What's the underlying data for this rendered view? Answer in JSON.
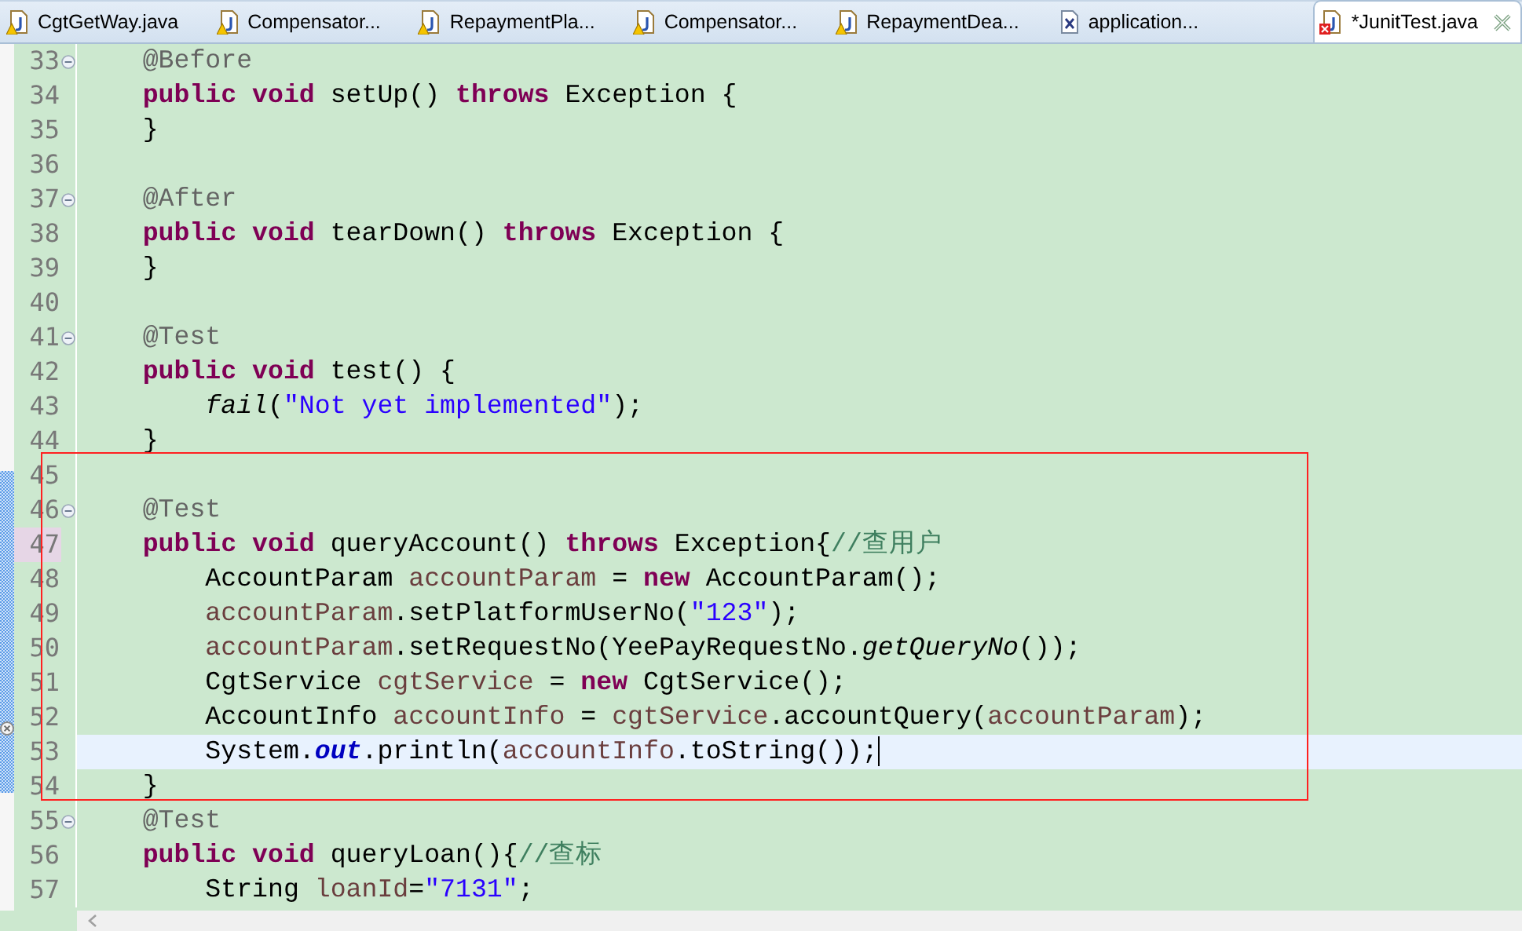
{
  "tabs": [
    {
      "label": "CgtGetWay.java",
      "kind": "java",
      "has_warning": true,
      "selected": false
    },
    {
      "label": "Compensator...",
      "kind": "java",
      "has_warning": true,
      "selected": false
    },
    {
      "label": "RepaymentPla...",
      "kind": "java",
      "has_warning": true,
      "selected": false
    },
    {
      "label": "Compensator...",
      "kind": "java",
      "has_warning": true,
      "selected": false
    },
    {
      "label": "RepaymentDea...",
      "kind": "java",
      "has_warning": true,
      "selected": false
    },
    {
      "label": "application...",
      "kind": "xml",
      "selected": false
    },
    {
      "label": "*JunitTest.java",
      "kind": "java",
      "has_error": true,
      "selected": true
    }
  ],
  "lines": [
    {
      "number": "33",
      "folding": true,
      "tokens": [
        {
          "kind": "annotation",
          "text": "    @Before"
        }
      ]
    },
    {
      "number": "34",
      "tokens": [
        {
          "kind": "keyword",
          "text": "    public void"
        },
        {
          "kind": "plain",
          "text": " setUp() "
        },
        {
          "kind": "keyword",
          "text": "throws"
        },
        {
          "kind": "plain",
          "text": " Exception {"
        }
      ]
    },
    {
      "number": "35",
      "tokens": [
        {
          "kind": "plain",
          "text": "    }"
        }
      ]
    },
    {
      "number": "36"
    },
    {
      "number": "37",
      "folding": true,
      "tokens": [
        {
          "kind": "annotation",
          "text": "    @After"
        }
      ]
    },
    {
      "number": "38",
      "tokens": [
        {
          "kind": "keyword",
          "text": "    public void"
        },
        {
          "kind": "plain",
          "text": " tearDown() "
        },
        {
          "kind": "keyword",
          "text": "throws"
        },
        {
          "kind": "plain",
          "text": " Exception {"
        }
      ]
    },
    {
      "number": "39",
      "tokens": [
        {
          "kind": "plain",
          "text": "    }"
        }
      ]
    },
    {
      "number": "40"
    },
    {
      "number": "41",
      "folding": true,
      "tokens": [
        {
          "kind": "annotation",
          "text": "    @Test"
        }
      ]
    },
    {
      "number": "42",
      "tokens": [
        {
          "kind": "keyword",
          "text": "    public void"
        },
        {
          "kind": "plain",
          "text": " test() {"
        }
      ]
    },
    {
      "number": "43",
      "tokens": [
        {
          "kind": "static-method",
          "text": "        fail"
        },
        {
          "kind": "plain",
          "text": "("
        },
        {
          "kind": "string",
          "text": "\"Not yet implemented\""
        },
        {
          "kind": "plain",
          "text": ");"
        }
      ]
    },
    {
      "number": "44",
      "tokens": [
        {
          "kind": "plain",
          "text": "    }"
        }
      ]
    },
    {
      "number": "45"
    },
    {
      "number": "46",
      "folding": true,
      "tokens": [
        {
          "kind": "annotation",
          "text": "    @Test"
        }
      ]
    },
    {
      "number": "47",
      "number_highlighted": true,
      "tokens": [
        {
          "kind": "keyword",
          "text": "    public void"
        },
        {
          "kind": "plain",
          "text": " queryAccount() "
        },
        {
          "kind": "keyword",
          "text": "throws"
        },
        {
          "kind": "plain",
          "text": " Exception{"
        },
        {
          "kind": "comment",
          "text": "//查用户"
        }
      ]
    },
    {
      "number": "48",
      "tokens": [
        {
          "kind": "plain",
          "text": "        AccountParam "
        },
        {
          "kind": "variable",
          "text": "accountParam"
        },
        {
          "kind": "plain",
          "text": " = "
        },
        {
          "kind": "keyword",
          "text": "new"
        },
        {
          "kind": "plain",
          "text": " AccountParam();"
        }
      ]
    },
    {
      "number": "49",
      "tokens": [
        {
          "kind": "variable",
          "text": "        accountParam"
        },
        {
          "kind": "plain",
          "text": ".setPlatformUserNo("
        },
        {
          "kind": "string",
          "text": "\"123\""
        },
        {
          "kind": "plain",
          "text": ");"
        }
      ]
    },
    {
      "number": "50",
      "tokens": [
        {
          "kind": "variable",
          "text": "        accountParam"
        },
        {
          "kind": "plain",
          "text": ".setRequestNo(YeePayRequestNo."
        },
        {
          "kind": "static-method",
          "text": "getQueryNo"
        },
        {
          "kind": "plain",
          "text": "());"
        }
      ]
    },
    {
      "number": "51",
      "tokens": [
        {
          "kind": "plain",
          "text": "        CgtService "
        },
        {
          "kind": "variable",
          "text": "cgtService"
        },
        {
          "kind": "plain",
          "text": " = "
        },
        {
          "kind": "keyword",
          "text": "new"
        },
        {
          "kind": "plain",
          "text": " CgtService();"
        }
      ]
    },
    {
      "number": "52",
      "error_marker": true,
      "tokens": [
        {
          "kind": "plain",
          "text": "        AccountInfo "
        },
        {
          "kind": "variable",
          "text": "accountInfo"
        },
        {
          "kind": "plain",
          "text": " = "
        },
        {
          "kind": "variable",
          "text": "cgtService"
        },
        {
          "kind": "plain",
          "text": ".accountQuery("
        },
        {
          "kind": "variable",
          "text": "accountParam"
        },
        {
          "kind": "plain",
          "text": ");"
        }
      ]
    },
    {
      "number": "53",
      "current": true,
      "tokens": [
        {
          "kind": "plain",
          "text": "        System."
        },
        {
          "kind": "static-field",
          "text": "out"
        },
        {
          "kind": "plain",
          "text": ".println("
        },
        {
          "kind": "variable",
          "text": "accountInfo"
        },
        {
          "kind": "plain",
          "text": ".toString());"
        }
      ]
    },
    {
      "number": "54",
      "tokens": [
        {
          "kind": "plain",
          "text": "    }"
        }
      ]
    },
    {
      "number": "55",
      "folding": true,
      "tokens": [
        {
          "kind": "annotation",
          "text": "    @Test"
        }
      ]
    },
    {
      "number": "56",
      "tokens": [
        {
          "kind": "keyword",
          "text": "    public void"
        },
        {
          "kind": "plain",
          "text": " queryLoan(){"
        },
        {
          "kind": "comment",
          "text": "//查标"
        }
      ]
    },
    {
      "number": "57",
      "tokens": [
        {
          "kind": "plain",
          "text": "        String "
        },
        {
          "kind": "variable",
          "text": "loanId"
        },
        {
          "kind": "plain",
          "text": "="
        },
        {
          "kind": "string",
          "text": "\"7131\""
        },
        {
          "kind": "plain",
          "text": ";"
        }
      ]
    }
  ]
}
